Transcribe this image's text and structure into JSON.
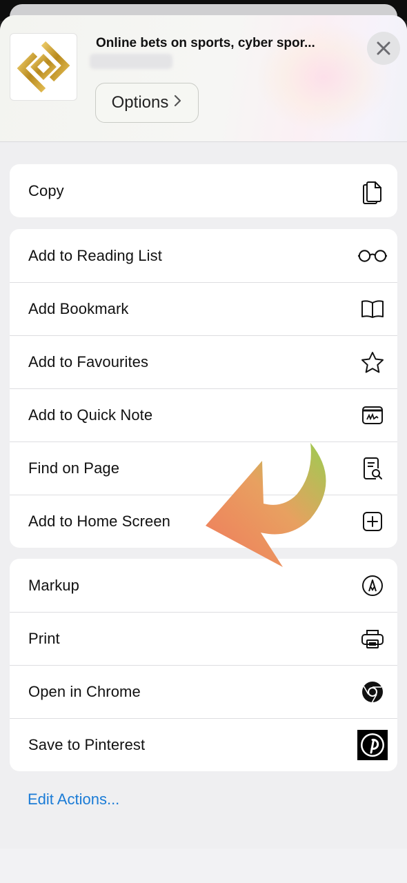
{
  "header": {
    "site_title": "Online bets on sports, cyber spor...",
    "options_label": "Options",
    "options_chevron": "›"
  },
  "groups": [
    {
      "items": [
        {
          "label": "Copy",
          "icon": "copy-icon"
        }
      ]
    },
    {
      "items": [
        {
          "label": "Add to Reading List",
          "icon": "glasses-icon"
        },
        {
          "label": "Add Bookmark",
          "icon": "book-icon"
        },
        {
          "label": "Add to Favourites",
          "icon": "star-icon"
        },
        {
          "label": "Add to Quick Note",
          "icon": "quick-note-icon"
        },
        {
          "label": "Find on Page",
          "icon": "find-on-page-icon"
        },
        {
          "label": "Add to Home Screen",
          "icon": "plus-square-icon"
        }
      ]
    },
    {
      "items": [
        {
          "label": "Markup",
          "icon": "markup-pen-icon"
        },
        {
          "label": "Print",
          "icon": "printer-icon"
        },
        {
          "label": "Open in Chrome",
          "icon": "chrome-icon"
        },
        {
          "label": "Save to Pinterest",
          "icon": "pinterest-icon"
        }
      ]
    }
  ],
  "footer": {
    "edit_actions_label": "Edit Actions..."
  },
  "colors": {
    "link": "#1a7bd6",
    "logo_gold": "#c9a227",
    "arrow_orange": "#f08a5a",
    "arrow_green": "#9cc65a"
  }
}
